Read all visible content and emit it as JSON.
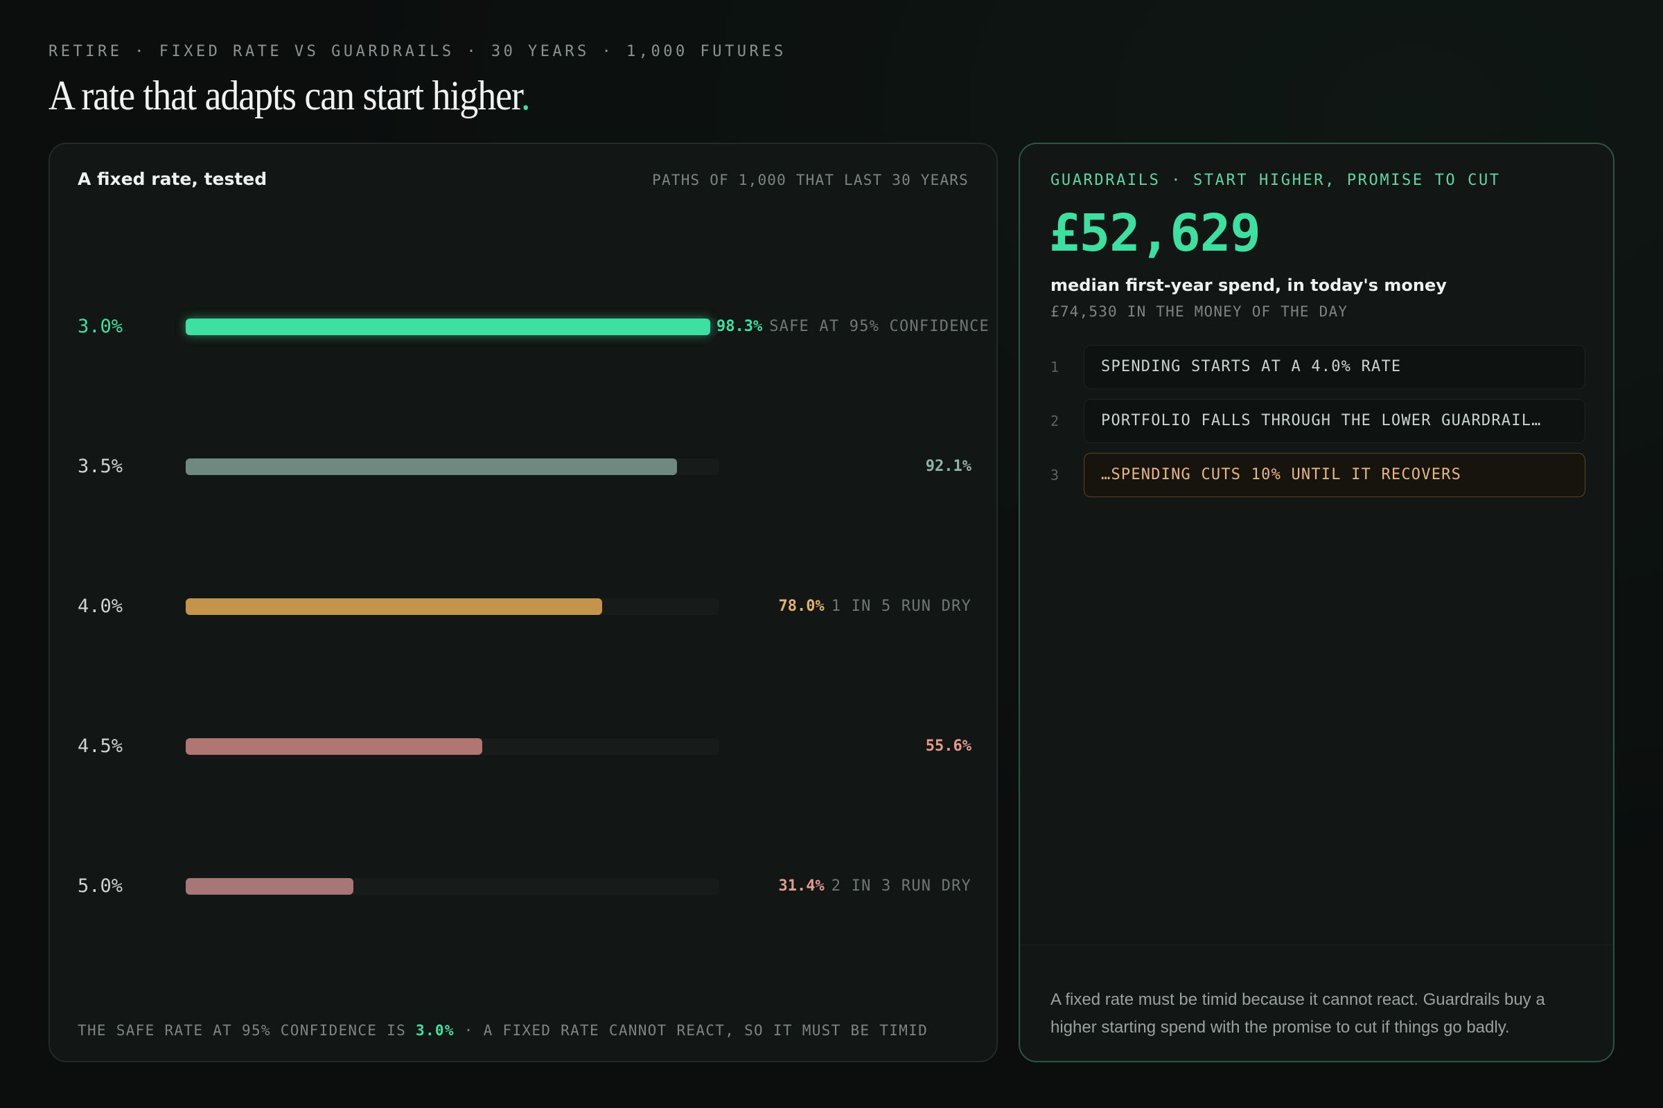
{
  "header": {
    "eyebrow": "RETIRE · FIXED RATE VS GUARDRAILS · 30 YEARS · 1,000 FUTURES",
    "title": "A rate that adapts can start higher",
    "title_dot": "."
  },
  "colors": {
    "accent": "#3ee0a1",
    "slate": "#6e8a80",
    "amber": "#c4944c",
    "rose_mid": "#b07672",
    "rose": "#a87676",
    "warn_text": "#e6b780"
  },
  "fixed_card": {
    "title": "A fixed rate, tested",
    "subtitle": "PATHS OF 1,000 THAT LAST 30 YEARS",
    "footnote_prefix": "THE SAFE RATE AT 95% CONFIDENCE IS ",
    "footnote_rate": "3.0%",
    "footnote_suffix": " · A FIXED RATE CANNOT REACT, SO IT MUST BE TIMID"
  },
  "chart_data": {
    "type": "bar",
    "orientation": "horizontal",
    "title": "A fixed rate, tested",
    "subtitle": "PATHS OF 1,000 THAT LAST 30 YEARS",
    "categories": [
      "3.0%",
      "3.5%",
      "4.0%",
      "4.5%",
      "5.0%"
    ],
    "values": [
      98.3,
      92.1,
      78.0,
      55.6,
      31.4
    ],
    "value_labels": [
      "98.3%",
      "92.1%",
      "78.0%",
      "55.6%",
      "31.4%"
    ],
    "notes": [
      "SAFE AT 95% CONFIDENCE",
      "",
      "1 IN 5 RUN DRY",
      "",
      "2 IN 3 RUN DRY"
    ],
    "bar_colors": [
      "#3ee0a1",
      "#6e8a80",
      "#c4944c",
      "#b07672",
      "#a87676"
    ],
    "label_colors": [
      "#3ee0a1",
      "#8fb4a6",
      "#e2b26e",
      "#e39b8e",
      "#e39b8e"
    ],
    "highlight_index": 0,
    "xlim": [
      0,
      100
    ],
    "grid": false,
    "legend": "none"
  },
  "guardrails_card": {
    "eyebrow": "GUARDRAILS · START HIGHER, PROMISE TO CUT",
    "big_value": "£52,629",
    "big_caption": "median first-year spend, in today's money",
    "small_caption": "£74,530 IN THE MONEY OF THE DAY",
    "steps": [
      {
        "num": "1",
        "text": "SPENDING STARTS AT A 4.0% RATE"
      },
      {
        "num": "2",
        "text": "PORTFOLIO FALLS THROUGH THE LOWER GUARDRAIL…"
      },
      {
        "num": "3",
        "text": "…SPENDING CUTS 10% UNTIL IT RECOVERS"
      }
    ],
    "footnote": "A fixed rate must be timid because it cannot react. Guardrails buy a higher starting spend with the promise to cut if things go badly."
  }
}
